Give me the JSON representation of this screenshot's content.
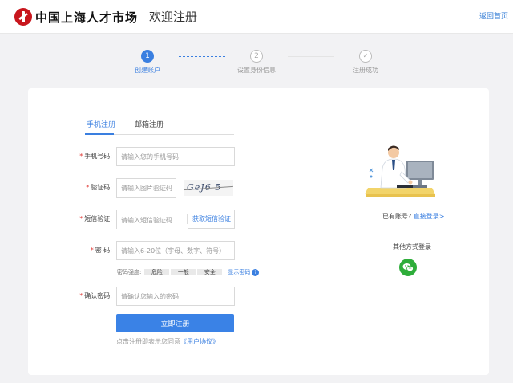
{
  "header": {
    "logo_text": "中国上海人才市场",
    "title": "欢迎注册",
    "back_link": "返回首页"
  },
  "steps": [
    {
      "number": "1",
      "label": "创建账户",
      "state": "active"
    },
    {
      "number": "2",
      "label": "设置身份信息",
      "state": "pending"
    },
    {
      "number": "✓",
      "label": "注册成功",
      "state": "pending"
    }
  ],
  "tabs": {
    "phone": "手机注册",
    "email": "邮箱注册"
  },
  "form": {
    "phone": {
      "label": "手机号码:",
      "placeholder": "请输入您的手机号码"
    },
    "captcha": {
      "label": "验证码:",
      "placeholder": "请输入图片验证码",
      "image_text": "GeJ6 5"
    },
    "sms": {
      "label": "短信验证:",
      "placeholder": "请输入短信验证码",
      "button": "获取短信验证"
    },
    "password": {
      "label": "密  码:",
      "placeholder": "请输入6-20位（字母、数字、符号）"
    },
    "strength": {
      "label": "密码强度:",
      "levels": [
        "危险",
        "一般",
        "安全"
      ],
      "show_password": "显示密码",
      "help": "?"
    },
    "confirm": {
      "label": "确认密码:",
      "placeholder": "请确认您输入的密码"
    },
    "submit": "立即注册",
    "agreement_prefix": "点击注册即表示您同意",
    "agreement_link": "《用户协议》",
    "required_mark": "*"
  },
  "side": {
    "has_account": "已有账号?",
    "login_link": "直接登录>",
    "other_login": "其他方式登录"
  },
  "colors": {
    "accent": "#3a7fe0",
    "wechat": "#2ead3a",
    "required": "#e0332f"
  }
}
